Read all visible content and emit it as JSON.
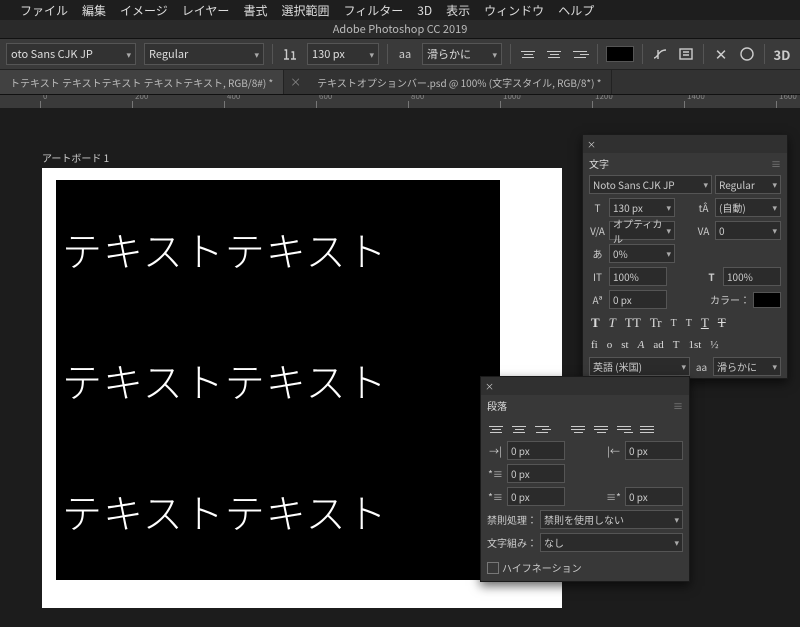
{
  "menu": {
    "apple": "",
    "items": [
      "ファイル",
      "編集",
      "イメージ",
      "レイヤー",
      "書式",
      "選択範囲",
      "フィルター",
      "3D",
      "表示",
      "ウィンドウ",
      "ヘルプ"
    ]
  },
  "app_title": "Adobe Photoshop CC 2019",
  "options": {
    "font_family": "oto Sans CJK JP",
    "font_style": "Regular",
    "font_size": "130 px",
    "aa": "aa",
    "aa_mode": "滑らかに",
    "three_d": "3D"
  },
  "tabs": [
    "トテキスト テキストテキスト テキストテキスト, RGB/8#) *",
    "テキストオプションバー.psd @ 100% (文字スタイル, RGB/8*) *"
  ],
  "ruler_marks": [
    "0",
    "200",
    "400",
    "600",
    "800",
    "1000",
    "1200",
    "1400",
    "1600"
  ],
  "artboard": {
    "label": "アートボード 1",
    "text": "テキストテキスト"
  },
  "char_panel": {
    "tab": "文字",
    "font_family": "Noto Sans CJK JP",
    "font_style": "Regular",
    "size": "130 px",
    "leading": "(自動)",
    "kerning": "オプティカル",
    "tracking": "0",
    "scale": "0%",
    "vscale": "100%",
    "hscale": "100%",
    "baseline": "0 px",
    "color_label": "カラー：",
    "style_glyphs": [
      "T",
      "T",
      "TT",
      "Tr",
      "T",
      "T",
      "T"
    ],
    "ot_glyphs": [
      "fi",
      "o",
      "st",
      "A",
      "ad",
      "T",
      "1st",
      "½"
    ],
    "lang": "英語 (米国)",
    "aa": "aa",
    "aa_mode": "滑らかに"
  },
  "para_panel": {
    "tab": "段落",
    "indent_left": "0 px",
    "indent_right": "0 px",
    "indent_first": "0 px",
    "space_before": "0 px",
    "space_after": "0 px",
    "kinsoku_label": "禁則処理：",
    "kinsoku": "禁則を使用しない",
    "mojikumi_label": "文字組み：",
    "mojikumi": "なし",
    "hyphen": "ハイフネーション"
  }
}
